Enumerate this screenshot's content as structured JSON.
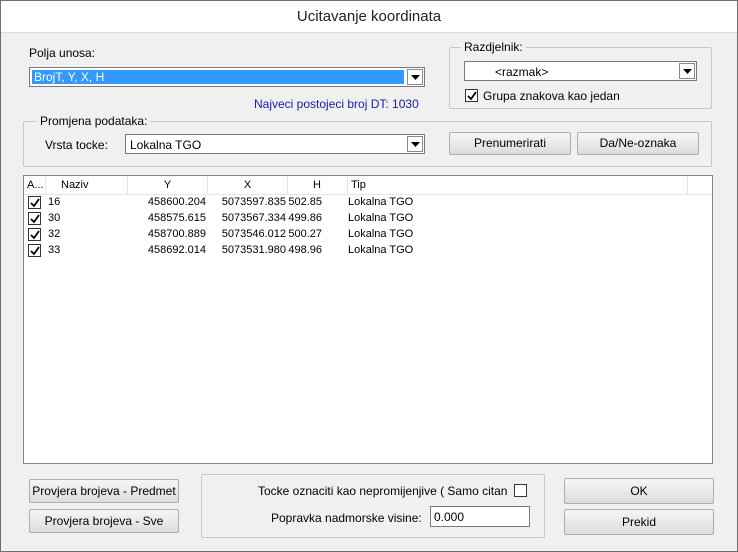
{
  "window": {
    "title": "Ucitavanje koordinata"
  },
  "input_fields": {
    "label": "Polja unosa:",
    "selected": "BrojT, Y, X, H",
    "max_dt_text": "Najveci postojeci broj DT: 1030"
  },
  "separator": {
    "group_label": "Razdjelnik:",
    "selected": "<razmak>",
    "group_chars_label": "Grupa znakova kao jedan",
    "group_chars_checked": true
  },
  "data_change": {
    "group_label": "Promjena podataka:",
    "point_type_label": "Vrsta tocke:",
    "point_type_selected": "Lokalna TGO",
    "renumber_label": "Prenumerirati",
    "yes_no_label": "Da/Ne-oznaka"
  },
  "table": {
    "columns": [
      "A...",
      "Naziv",
      "Y",
      "X",
      "H",
      "Tip"
    ],
    "rows": [
      {
        "checked": true,
        "naziv": "16",
        "y": "458600.204",
        "x": "5073597.835",
        "h": "502.85",
        "tip": "Lokalna TGO"
      },
      {
        "checked": true,
        "naziv": "30",
        "y": "458575.615",
        "x": "5073567.334",
        "h": "499.86",
        "tip": "Lokalna TGO"
      },
      {
        "checked": true,
        "naziv": "32",
        "y": "458700.889",
        "x": "5073546.012",
        "h": "500.27",
        "tip": "Lokalna TGO"
      },
      {
        "checked": true,
        "naziv": "33",
        "y": "458692.014",
        "x": "5073531.980",
        "h": "498.96",
        "tip": "Lokalna TGO"
      }
    ]
  },
  "bottom": {
    "check_subject_label": "Provjera brojeva - Predmet",
    "check_all_label": "Provjera brojeva - Sve",
    "readonly_label": "Tocke oznaciti kao nepromijenjive ( Samo citan",
    "readonly_checked": false,
    "height_correction_label": "Popravka nadmorske visine:",
    "height_correction_value": "0.000",
    "ok_label": "OK",
    "cancel_label": "Prekid"
  }
}
